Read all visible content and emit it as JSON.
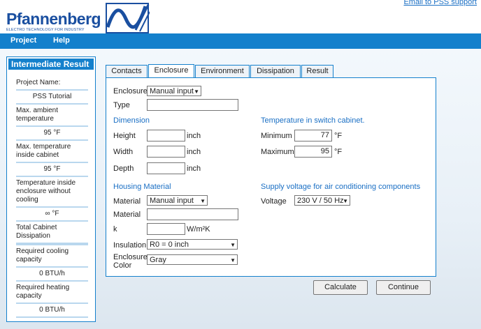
{
  "header": {
    "brand": "Pfannenberg",
    "tagline": "ELECTRO TECHNOLOGY FOR INDUSTRY",
    "email_link": "Email to PSS support",
    "colors": {
      "brand_blue": "#1a4fa0",
      "menu_blue": "#1480cc"
    }
  },
  "menu": {
    "items": [
      "Project",
      "Help"
    ]
  },
  "sidebar": {
    "title": "Intermediate Result",
    "rows": [
      {
        "label": "Project Name:",
        "value": "PSS Tutorial"
      },
      {
        "label": "Max. ambient temperature",
        "value": "95 °F"
      },
      {
        "label": "Max. temperature inside cabinet",
        "value": "95 °F"
      },
      {
        "label": "Temperature inside enclosure without cooling",
        "value": "∞ °F"
      },
      {
        "label": "Total Cabinet Dissipation",
        "value": ""
      },
      {
        "label": "Required cooling capacity",
        "value": "0 BTU/h"
      },
      {
        "label": "Required heating capacity",
        "value": "0 BTU/h"
      }
    ]
  },
  "tabs": [
    {
      "label": "Contacts",
      "active": false
    },
    {
      "label": "Enclosure",
      "active": true
    },
    {
      "label": "Environment",
      "active": false
    },
    {
      "label": "Dissipation",
      "active": false
    },
    {
      "label": "Result",
      "active": false
    }
  ],
  "form": {
    "enclosure_label": "Enclosure",
    "enclosure_select": "Manual input",
    "type_label": "Type",
    "type_value": "",
    "dimension": {
      "title": "Dimension",
      "height_label": "Height",
      "height_value": "",
      "height_unit": "inch",
      "width_label": "Width",
      "width_value": "",
      "width_unit": "inch",
      "depth_label": "Depth",
      "depth_value": "",
      "depth_unit": "inch"
    },
    "temperature": {
      "title": "Temperature in switch cabinet.",
      "min_label": "Minimum",
      "min_value": "77",
      "min_unit": "°F",
      "max_label": "Maximum",
      "max_value": "95",
      "max_unit": "°F"
    },
    "housing": {
      "title": "Housing Material",
      "material_label": "Material",
      "material_select": "Manual input",
      "material2_label": "Material",
      "material2_value": "",
      "k_label": "k",
      "k_value": "",
      "k_unit": "W/m²K",
      "insulation_label": "Insulation",
      "insulation_select": "R0 = 0 inch",
      "color_label": "Enclosure Color",
      "color_select": "Gray"
    },
    "supply": {
      "title": "Supply voltage for air conditioning components",
      "voltage_label": "Voltage",
      "voltage_select": "230 V / 50 Hz"
    }
  },
  "buttons": {
    "calculate": "Calculate",
    "continue": "Continue"
  }
}
